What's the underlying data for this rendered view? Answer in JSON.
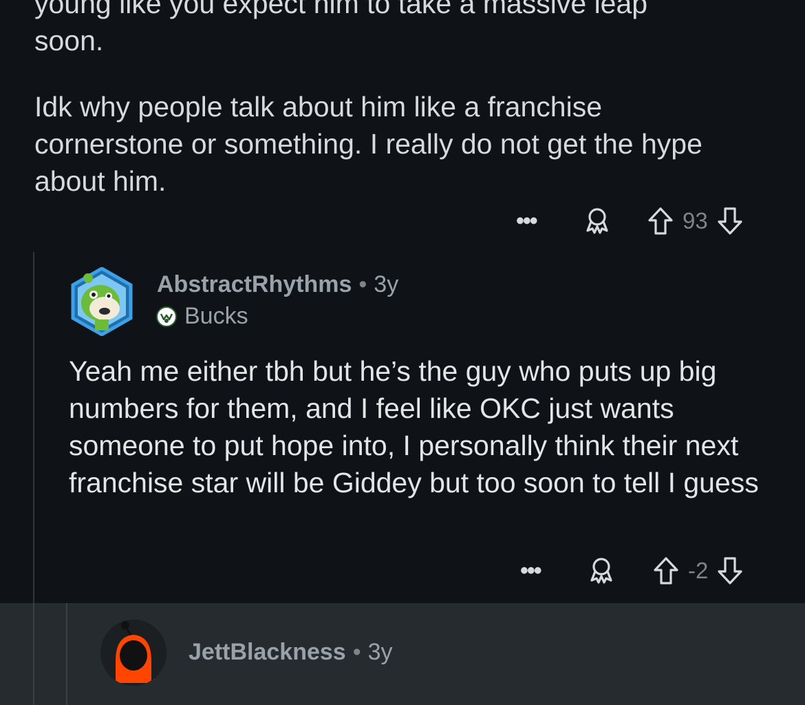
{
  "parent_comment": {
    "cut_line": "young like you expect him to take a massive leap",
    "paragraph_1_end": "soon.",
    "paragraph_2": "Idk why people talk about him like a franchise cornerstone or something. I really do not get the hype about him.",
    "vote_count": "93"
  },
  "reply": {
    "username": "AbstractRhythms",
    "separator": "•",
    "age": "3y",
    "flair": "Bucks",
    "body": "Yeah me either tbh but he’s the guy who puts up big numbers for them, and I feel like OKC just wants someone to put hope into, I personally think their next franchise star will be Giddey but too soon to tell I guess",
    "vote_count": "-2"
  },
  "nested_reply": {
    "username": "JettBlackness",
    "separator": "•",
    "age": "3y"
  },
  "actions": {
    "more_label": "•••"
  },
  "colors": {
    "background": "#0f1216",
    "nested_background": "#262b30",
    "text_primary": "#d7dadc",
    "text_muted": "#818384",
    "username": "#9aa2a9",
    "avatar_ring": "#2b8fd6",
    "snoo_orange": "#ff4500"
  }
}
